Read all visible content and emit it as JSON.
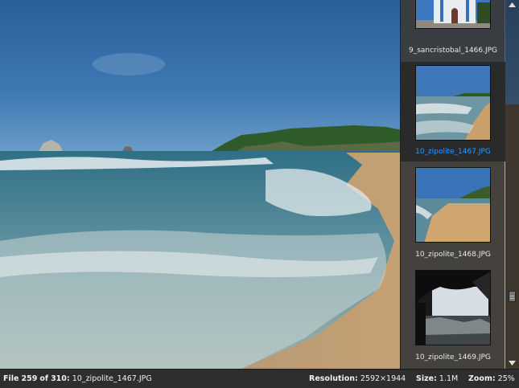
{
  "status": {
    "file_label": "File",
    "file_index": "259",
    "of_label": "of",
    "file_total": "310:",
    "file_name": "10_zipolite_1467.JPG",
    "resolution_label": "Resolution:",
    "resolution_value": "2592×1944",
    "size_label": "Size:",
    "size_value": "1.1M",
    "zoom_label": "Zoom:",
    "zoom_value": "25%"
  },
  "thumbnails": [
    {
      "label": "9_sancristobal_1466.JPG",
      "icon": "church-photo",
      "selected": false
    },
    {
      "label": "10_zipolite_1467.JPG",
      "icon": "beach-photo",
      "selected": true
    },
    {
      "label": "10_zipolite_1468.JPG",
      "icon": "beach-photo",
      "selected": false
    },
    {
      "label": "10_zipolite_1469.JPG",
      "icon": "palapa-photo",
      "selected": false
    }
  ],
  "colors": {
    "selected_label": "#2f9bff",
    "sky": "#2f6aa6",
    "sea": "#5d8a9c",
    "sand": "#c9a57a"
  }
}
